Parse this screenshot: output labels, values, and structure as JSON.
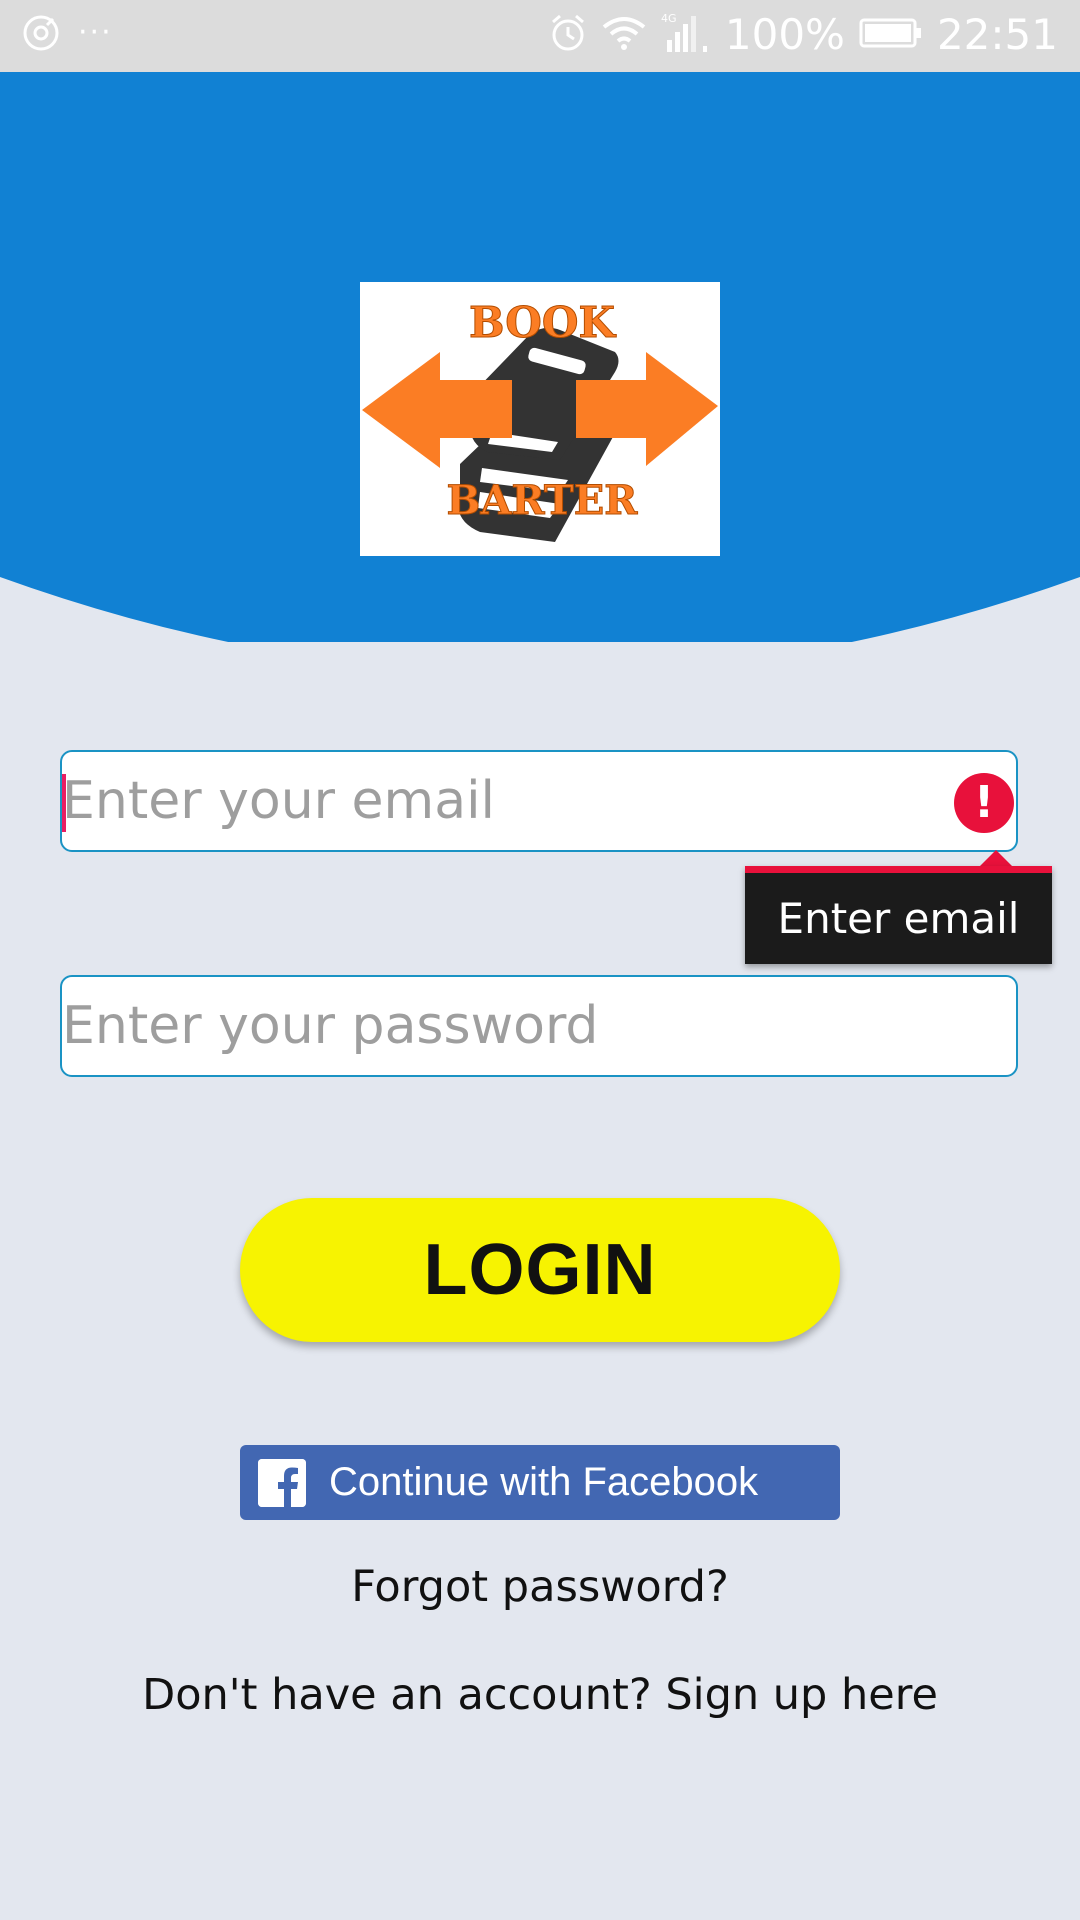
{
  "status_bar": {
    "dots": "···",
    "network": "4G",
    "battery": "100%",
    "time": "22:51"
  },
  "logo": {
    "top_text": "BOOK",
    "bottom_text": "BARTER"
  },
  "form": {
    "email_placeholder": "Enter your email",
    "password_placeholder": "Enter your password",
    "email_error": "Enter email",
    "login_label": "LOGIN",
    "facebook_label": "Continue with Facebook",
    "forgot_label": "Forgot password?",
    "signup_label": "Don't have an account? Sign up here"
  },
  "colors": {
    "header": "#1181d3",
    "background": "#e3e7ef",
    "login_button": "#f7f301",
    "facebook": "#4267b2",
    "error": "#e8113b",
    "logo_orange": "#fb7d24",
    "logo_dark": "#333333"
  },
  "icons": {
    "status_left": "sync-disc-icon",
    "alarm": "alarm-icon",
    "wifi": "wifi-icon",
    "signal": "signal-icon",
    "battery": "battery-icon",
    "error": "error-icon",
    "facebook": "facebook-f-icon"
  }
}
